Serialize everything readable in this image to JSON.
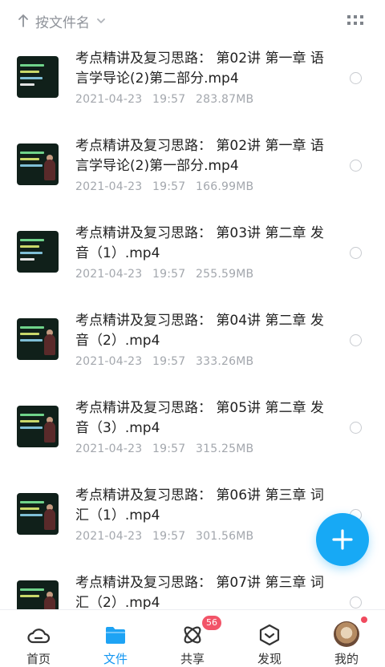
{
  "sort": {
    "label": "按文件名"
  },
  "files": [
    {
      "title": "考点精讲及复习思路： 第02讲 第一章 语言学导论(2)第二部分.mp4",
      "date": "2021-04-23",
      "time": "19:57",
      "size": "283.87MB"
    },
    {
      "title": "考点精讲及复习思路： 第02讲 第一章 语言学导论(2)第一部分.mp4",
      "date": "2021-04-23",
      "time": "19:57",
      "size": "166.99MB"
    },
    {
      "title": "考点精讲及复习思路： 第03讲 第二章 发音（1）.mp4",
      "date": "2021-04-23",
      "time": "19:57",
      "size": "255.59MB"
    },
    {
      "title": "考点精讲及复习思路： 第04讲 第二章 发音（2）.mp4",
      "date": "2021-04-23",
      "time": "19:57",
      "size": "333.26MB"
    },
    {
      "title": "考点精讲及复习思路： 第05讲 第二章 发音（3）.mp4",
      "date": "2021-04-23",
      "time": "19:57",
      "size": "315.25MB"
    },
    {
      "title": "考点精讲及复习思路： 第06讲 第三章 词汇（1）.mp4",
      "date": "2021-04-23",
      "time": "19:57",
      "size": "301.56MB"
    },
    {
      "title": "考点精讲及复习思路： 第07讲 第三章 词汇（2）.mp4",
      "date": "",
      "time": "",
      "size": ""
    }
  ],
  "tabs": [
    {
      "label": "首页",
      "icon": "cloud-icon"
    },
    {
      "label": "文件",
      "icon": "folder-icon",
      "active": true
    },
    {
      "label": "共享",
      "icon": "share-atom-icon",
      "badge": "56"
    },
    {
      "label": "发现",
      "icon": "hexagon-discover-icon"
    },
    {
      "label": "我的",
      "icon": "avatar"
    }
  ],
  "colors": {
    "accent": "#1497f2",
    "fab": "#17a9f5",
    "badge": "#f25468",
    "muted": "#a3a7ad"
  }
}
